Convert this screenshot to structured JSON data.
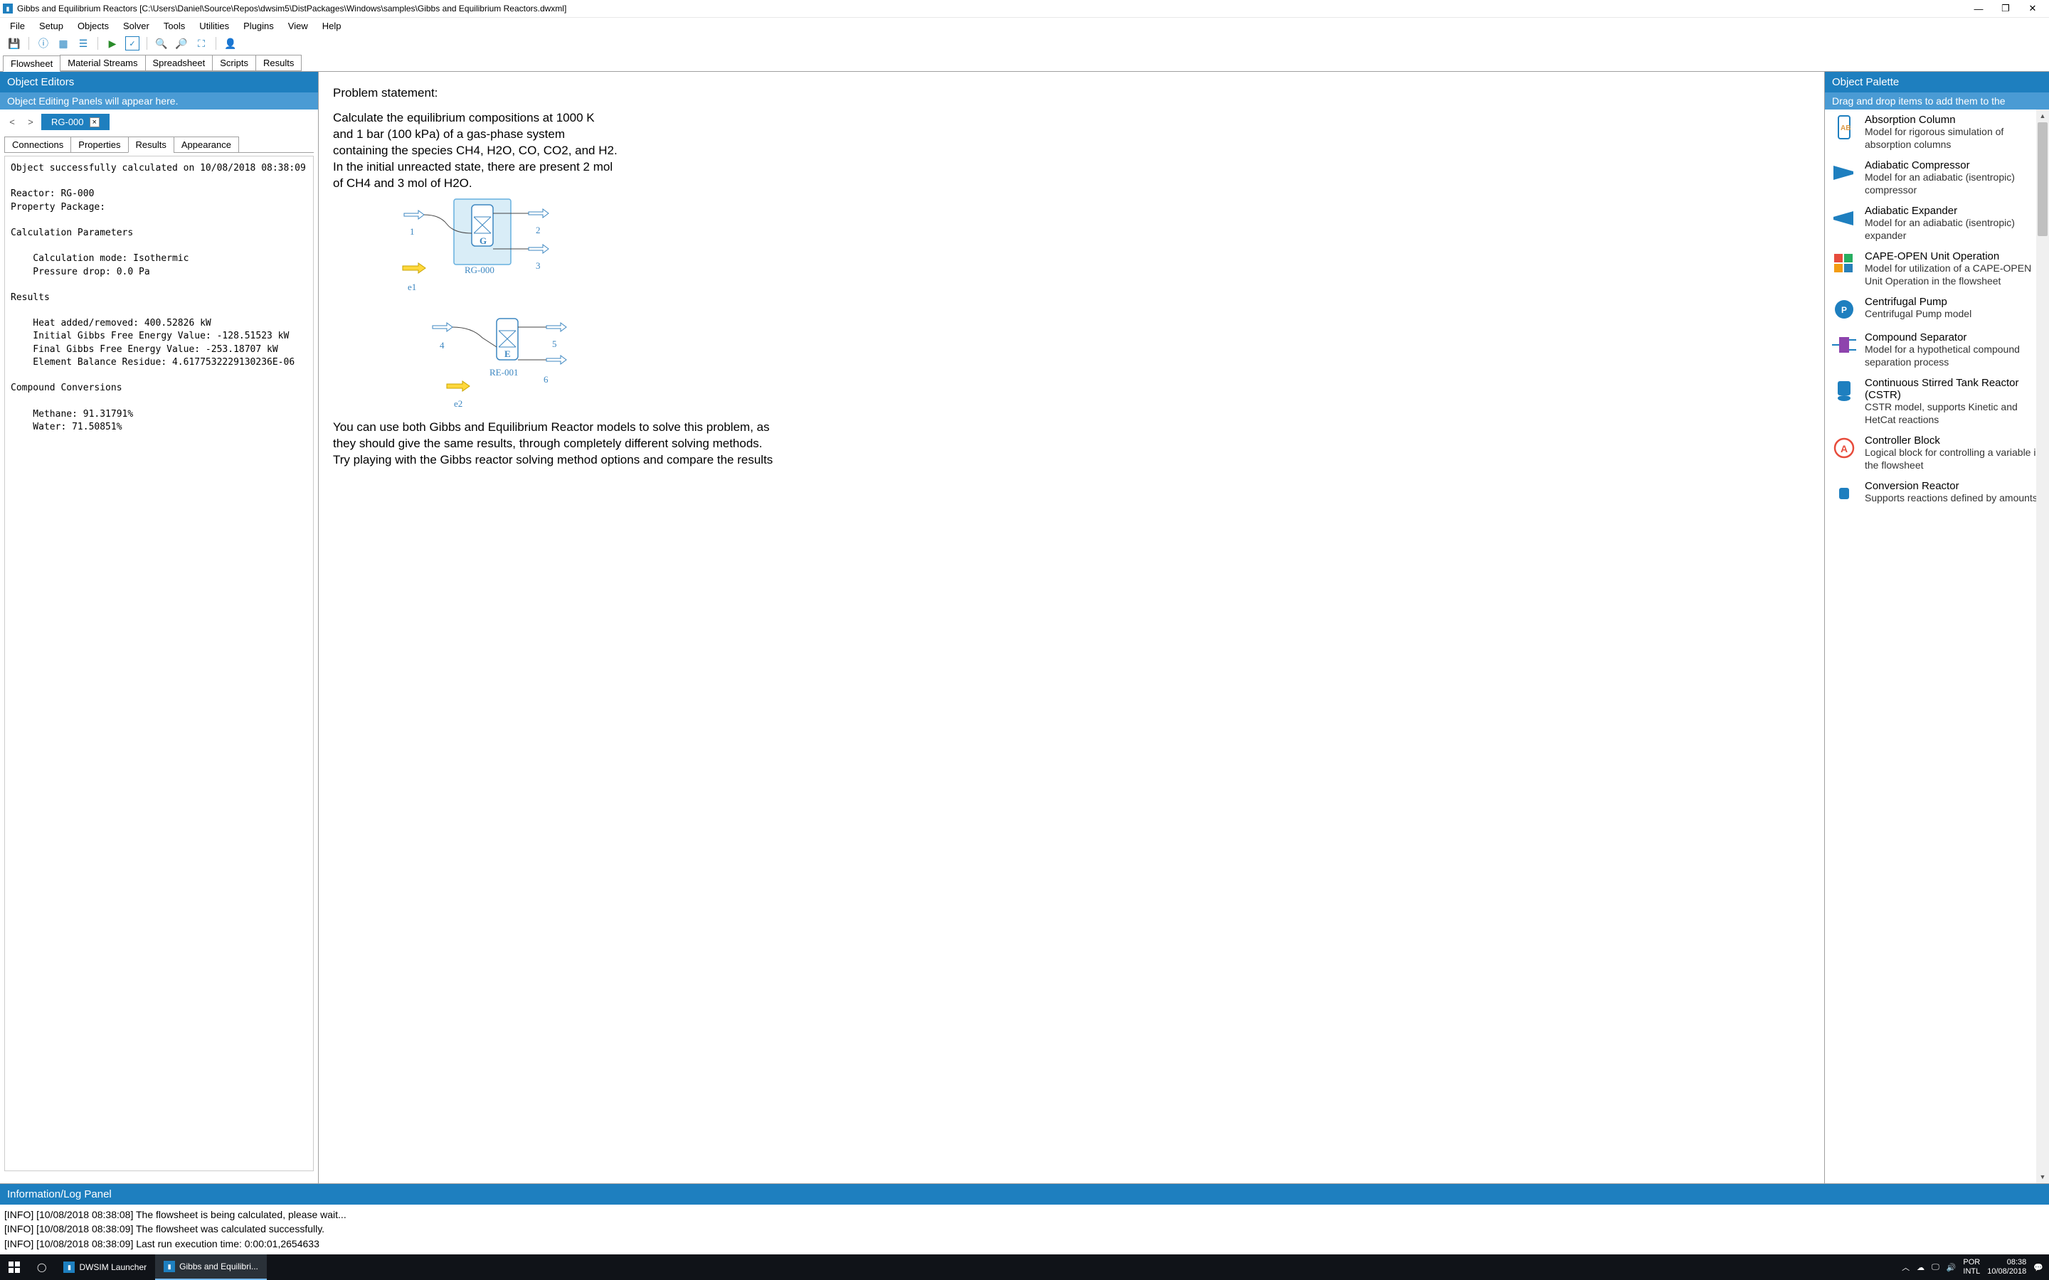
{
  "titlebar": {
    "title": "Gibbs and Equilibrium Reactors [C:\\Users\\Daniel\\Source\\Repos\\dwsim5\\DistPackages\\Windows\\samples\\Gibbs and Equilibrium Reactors.dwxml]"
  },
  "menu": [
    "File",
    "Setup",
    "Objects",
    "Solver",
    "Tools",
    "Utilities",
    "Plugins",
    "View",
    "Help"
  ],
  "doctabs": [
    "Flowsheet",
    "Material Streams",
    "Spreadsheet",
    "Scripts",
    "Results"
  ],
  "left": {
    "header": "Object Editors",
    "sub": "Object Editing Panels will appear here.",
    "obj_tab": "RG-000",
    "subtabs": [
      "Connections",
      "Properties",
      "Results",
      "Appearance"
    ],
    "results_text": "Object successfully calculated on 10/08/2018 08:38:09\n\nReactor: RG-000\nProperty Package: \n\nCalculation Parameters\n\n    Calculation mode: Isothermic\n    Pressure drop: 0.0 Pa\n\nResults\n\n    Heat added/removed: 400.52826 kW\n    Initial Gibbs Free Energy Value: -128.51523 kW\n    Final Gibbs Free Energy Value: -253.18707 kW\n    Element Balance Residue: 4.6177532229130236E-06\n\nCompound Conversions\n\n    Methane: 91.31791%\n    Water: 71.50851%"
  },
  "center": {
    "title": "Problem statement:",
    "body": "Calculate the equilibrium compositions at 1000 K and 1 bar (100 kPa) of a gas-phase system containing the species CH4, H2O, CO, CO2, and H2. In the initial unreacted state, there are present 2 mol of CH4 and 3 mol of H2O.",
    "diagram": {
      "r1": "RG-000",
      "r1_type": "G",
      "r2": "RE-001",
      "r2_type": "E",
      "s1": "1",
      "s2": "2",
      "s3": "3",
      "s4": "4",
      "s5": "5",
      "s6": "6",
      "e1": "e1",
      "e2": "e2"
    },
    "notes": "You can use both Gibbs and Equilibrium Reactor models to solve this problem, as they should give the same results, through completely different solving methods. Try playing with the Gibbs reactor solving method options and compare the results"
  },
  "right": {
    "header": "Object Palette",
    "sub": "Drag and drop items to add them to the",
    "items": [
      {
        "title": "Absorption Column",
        "desc": "Model for rigorous simulation of absorption columns"
      },
      {
        "title": "Adiabatic Compressor",
        "desc": "Model for an adiabatic (isentropic) compressor"
      },
      {
        "title": "Adiabatic Expander",
        "desc": "Model for an adiabatic (isentropic) expander"
      },
      {
        "title": "CAPE-OPEN Unit Operation",
        "desc": "Model for utilization of a CAPE-OPEN Unit Operation in the flowsheet"
      },
      {
        "title": "Centrifugal Pump",
        "desc": "Centrifugal Pump model"
      },
      {
        "title": "Compound Separator",
        "desc": "Model for a hypothetical compound separation process"
      },
      {
        "title": "Continuous Stirred Tank Reactor (CSTR)",
        "desc": "CSTR model, supports Kinetic and HetCat reactions"
      },
      {
        "title": "Controller Block",
        "desc": "Logical block for controlling a variable in the flowsheet"
      },
      {
        "title": "Conversion Reactor",
        "desc": "Supports reactions defined by amounts"
      }
    ]
  },
  "log": {
    "header": "Information/Log Panel",
    "lines": [
      "[INFO] [10/08/2018 08:38:08] The flowsheet is being calculated, please wait...",
      "[INFO] [10/08/2018 08:38:09] The flowsheet was calculated successfully.",
      "[INFO] [10/08/2018 08:38:09] Last run execution time: 0:00:01,2654633"
    ]
  },
  "taskbar": {
    "app1": "DWSIM Launcher",
    "app2": "Gibbs and Equilibri...",
    "lang": "POR",
    "kb": "INTL",
    "time": "08:38",
    "date": "10/08/2018"
  }
}
